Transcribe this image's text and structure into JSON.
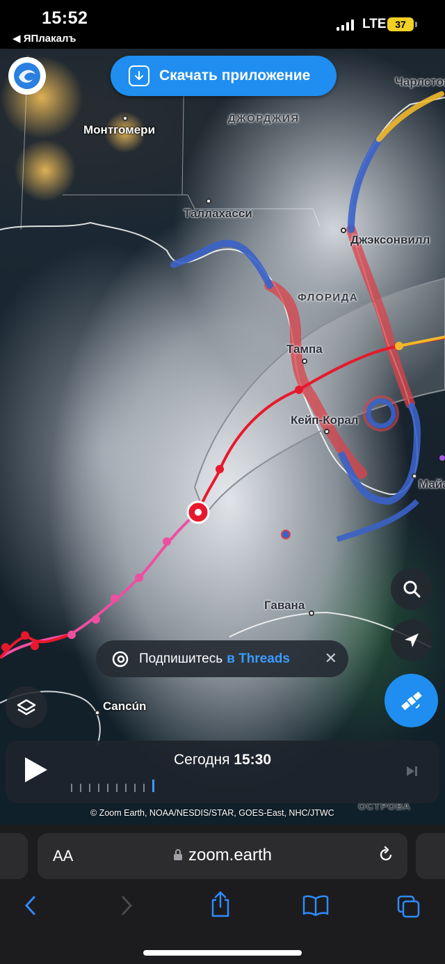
{
  "status_bar": {
    "time": "15:52",
    "back_app": "◀ ЯПлакалъ",
    "network": "LTE",
    "battery": "37"
  },
  "banner": {
    "download_label": "Скачать приложение"
  },
  "map": {
    "labels": {
      "montgomery": "Монтгомери",
      "georgia": "ДЖОРДЖИЯ",
      "charleston": "Чарлстон",
      "tallahassee": "Таллахасси",
      "jacksonville": "Джэксонвилл",
      "florida": "ФЛОРИДА",
      "tampa": "Тампа",
      "cape_coral": "Кейп-Корал",
      "miami": "Майами",
      "havana": "Гавана",
      "cancun": "Cancún",
      "islands": "ОСТРОВА"
    },
    "attribution": "© Zoom Earth, NOAA/NESDIS/STAR, GOES-East, NHC/JTWC"
  },
  "threads": {
    "text": "Подпишитесь",
    "link": "в Threads"
  },
  "timeline": {
    "day": "Сегодня",
    "time": "15:30",
    "tick_count": 10
  },
  "safari": {
    "aa_label": "AA",
    "url": "zoom.earth"
  },
  "icons": {
    "logo": "zoom-earth-logo-icon",
    "download": "download-icon",
    "threads": "threads-icon",
    "close": "close-icon",
    "layers": "layers-icon",
    "search": "search-icon",
    "locate": "location-arrow-icon",
    "satellite": "satellite-icon",
    "play": "play-icon",
    "skip": "skip-end-icon",
    "lock": "lock-icon",
    "reload": "reload-icon",
    "back": "chevron-left-icon",
    "forward": "chevron-right-icon",
    "share": "share-icon",
    "bookmarks": "book-icon",
    "tabs": "tabs-icon"
  },
  "colors": {
    "accent": "#1f8ef0",
    "track_forecast": "#e8182c",
    "track_past": "#ee4fa0",
    "warning_red": "#d9424a",
    "watch_blue": "#3a62c8",
    "yellow": "#f0b82a"
  }
}
